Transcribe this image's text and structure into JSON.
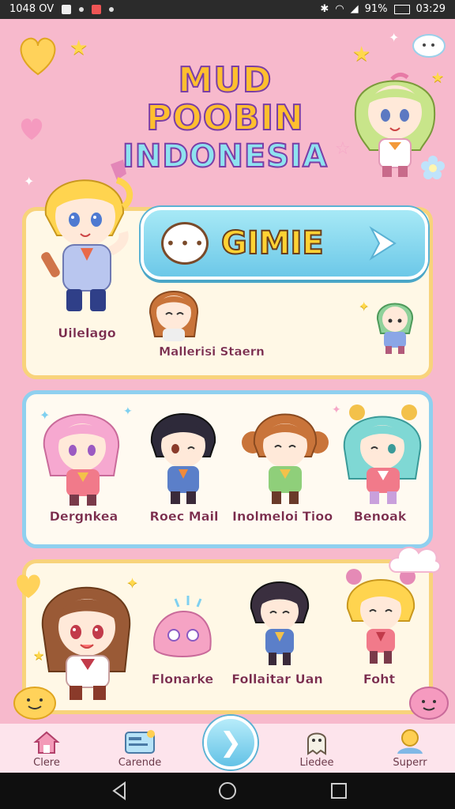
{
  "status_bar": {
    "left_text": "1048 OV",
    "battery_text": "91%",
    "time": "03:29"
  },
  "title": {
    "line1": "MUD POOBIN",
    "line2": "INDONESIA"
  },
  "game_button": {
    "label": "GIMIE"
  },
  "panel1": {
    "captions": [
      "Uilelago",
      "Mallerisi Staern"
    ]
  },
  "panel2": {
    "captions": [
      "Dergnkea",
      "Roec Mail",
      "Inolmeloi Tioo",
      "Benoak"
    ]
  },
  "panel3": {
    "captions": [
      "Flonarke",
      "Follaitar Uan",
      "Foht"
    ]
  },
  "bottom_nav": {
    "items": [
      {
        "label": "Clere",
        "icon": "home-icon"
      },
      {
        "label": "Carende",
        "icon": "card-icon"
      },
      {
        "label": "",
        "icon": "chevron-right-icon"
      },
      {
        "label": "Liedee",
        "icon": "ghost-icon"
      },
      {
        "label": "Superr",
        "icon": "user-icon"
      }
    ]
  },
  "colors": {
    "background": "#f7b9cc",
    "panel_yellow_border": "#f8d37b",
    "panel_blue_border": "#8fd0ef",
    "button_blue": "#6cc8e8",
    "title_yellow": "#ffbf2e",
    "title_cyan": "#8ee3f0"
  }
}
